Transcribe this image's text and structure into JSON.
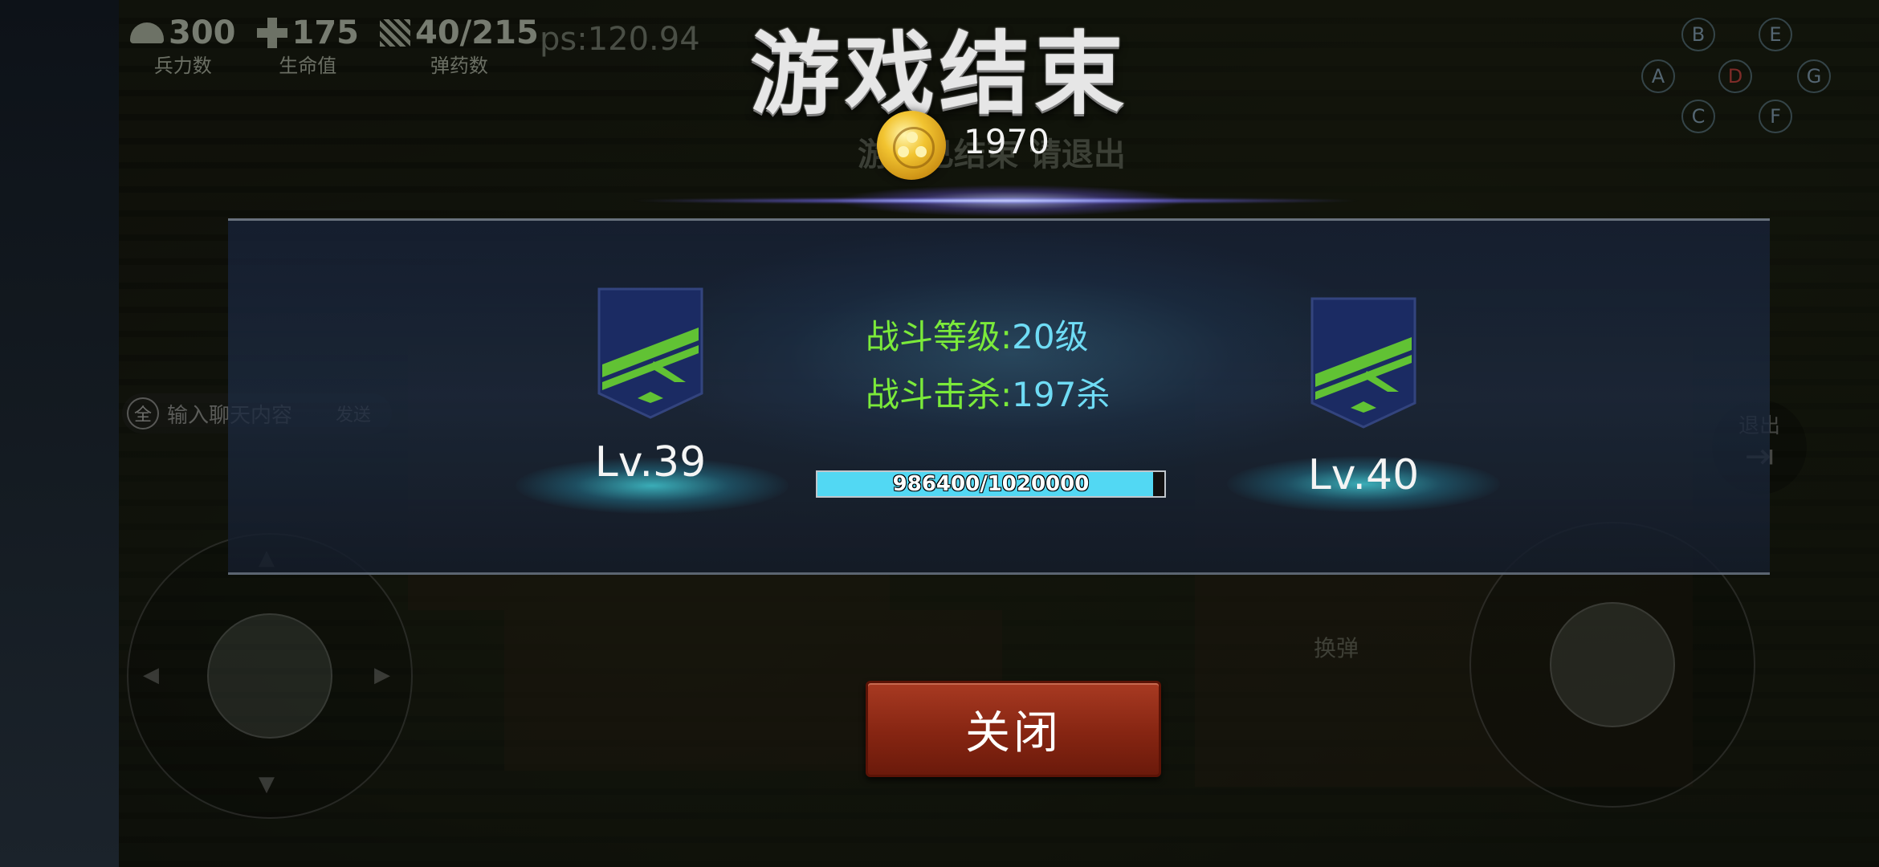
{
  "hud": {
    "troops_value": "300",
    "troops_label": "兵力数",
    "health_value": "175",
    "health_label": "生命值",
    "ammo_value": "40/215",
    "ammo_label": "弹药数",
    "fps_text": "ps:120.94"
  },
  "background": {
    "exit_notice": "游戏已结束 请退出",
    "dpad_letters": [
      "B",
      "E",
      "A",
      "D",
      "G",
      "C",
      "F"
    ],
    "chat_all": "全",
    "chat_placeholder": "输入聊天内容",
    "chat_send": "发送",
    "exit_label": "退出",
    "reload_label": "换弹"
  },
  "result": {
    "title": "游戏结束",
    "coins": "1970",
    "level_from": "Lv.39",
    "level_to": "Lv.40",
    "battle_level_key": "战斗等级:",
    "battle_level_value": "20级",
    "kills_key": "战斗击杀:",
    "kills_value": "197杀",
    "xp_text": "986400/1020000",
    "xp_fraction": 0.967,
    "close_label": "关闭"
  },
  "colors": {
    "stat_key": "#7bea3a",
    "stat_value": "#6fdcf5",
    "xp_fill": "#52d8f3",
    "close_button": "#862512"
  },
  "icons": [
    "helmet-icon",
    "health-cross-icon",
    "ammo-icon",
    "coin-icon",
    "rank-badge-icon",
    "exit-icon",
    "bullet-icon"
  ]
}
